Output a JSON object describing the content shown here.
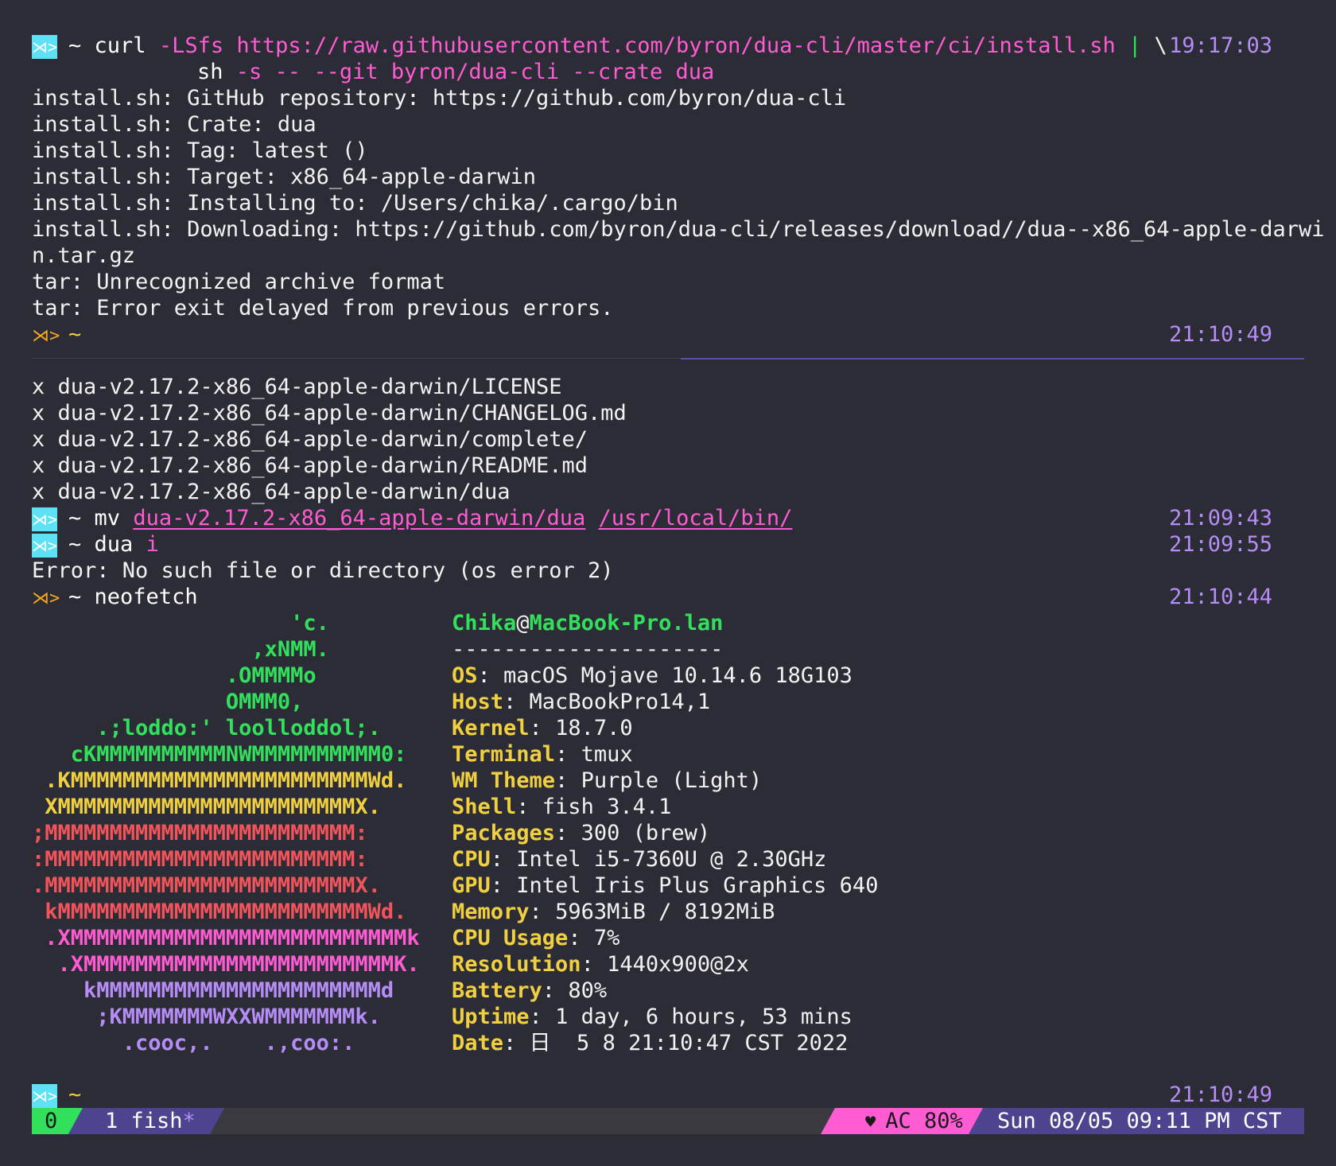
{
  "prompt_icon": "fish-prompt-icon",
  "colors": {
    "background": "#2c2c36",
    "time": "#b68cf7",
    "arg": "#ff5bd3",
    "green": "#32e05c",
    "yellow": "#f0d040",
    "cyan": "#5ee1f5",
    "purple": "#4c448f"
  },
  "block1": {
    "prompt_dir": "~",
    "cmd": "curl",
    "flag1": "-LSfs",
    "url": "https://raw.githubusercontent.com/byron/dua-cli/master/ci/install.sh",
    "pipe": "|",
    "backslash": "\\",
    "time": "19:17:03",
    "cont_cmd": "sh",
    "cont_args": "-s -- --git byron/dua-cli --crate dua",
    "output": [
      "install.sh: GitHub repository: https://github.com/byron/dua-cli",
      "install.sh: Crate: dua",
      "install.sh: Tag: latest ()",
      "install.sh: Target: x86_64-apple-darwin",
      "install.sh: Installing to: /Users/chika/.cargo/bin",
      "install.sh: Downloading: https://github.com/byron/dua-cli/releases/download//dua--x86_64-apple-darwi",
      "n.tar.gz",
      "tar: Unrecognized archive format",
      "tar: Error exit delayed from previous errors."
    ],
    "prompt2_dir": "~",
    "prompt2_time": "21:10:49"
  },
  "block2": {
    "tar_output": [
      "x dua-v2.17.2-x86_64-apple-darwin/LICENSE",
      "x dua-v2.17.2-x86_64-apple-darwin/CHANGELOG.md",
      "x dua-v2.17.2-x86_64-apple-darwin/complete/",
      "x dua-v2.17.2-x86_64-apple-darwin/README.md",
      "x dua-v2.17.2-x86_64-apple-darwin/dua"
    ],
    "mv": {
      "dir": "~",
      "cmd": "mv",
      "src": "dua-v2.17.2-x86_64-apple-darwin/dua",
      "dst": "/usr/local/bin/",
      "time": "21:09:43"
    },
    "dua": {
      "dir": "~",
      "cmd": "dua",
      "arg": "i",
      "time": "21:09:55"
    },
    "error": "Error: No such file or directory (os error 2)",
    "neofetch": {
      "dir": "~",
      "cmd": "neofetch",
      "time": "21:10:44"
    }
  },
  "neofetch": {
    "art": [
      {
        "text": "                    'c.",
        "color": "#32e05c"
      },
      {
        "text": "                 ,xNMM.",
        "color": "#32e05c"
      },
      {
        "text": "               .OMMMMo",
        "color": "#32e05c"
      },
      {
        "text": "               OMMM0,",
        "color": "#32e05c"
      },
      {
        "text": "     .;loddo:' loolloddol;.",
        "color": "#32e05c"
      },
      {
        "text": "   cKMMMMMMMMMMNWMMMMMMMMMM0:",
        "color": "#32e05c"
      },
      {
        "text": " .KMMMMMMMMMMMMMMMMMMMMMMMWd.",
        "color": "#f0d040"
      },
      {
        "text": " XMMMMMMMMMMMMMMMMMMMMMMMX.",
        "color": "#f0d040"
      },
      {
        "text": ";MMMMMMMMMMMMMMMMMMMMMMMM:",
        "color": "#f2545b"
      },
      {
        "text": ":MMMMMMMMMMMMMMMMMMMMMMMM:",
        "color": "#f2545b"
      },
      {
        "text": ".MMMMMMMMMMMMMMMMMMMMMMMMX.",
        "color": "#f2545b"
      },
      {
        "text": " kMMMMMMMMMMMMMMMMMMMMMMMMWd.",
        "color": "#f2545b"
      },
      {
        "text": " .XMMMMMMMMMMMMMMMMMMMMMMMMMMk",
        "color": "#ff5bd3"
      },
      {
        "text": "  .XMMMMMMMMMMMMMMMMMMMMMMMMK.",
        "color": "#ff5bd3"
      },
      {
        "text": "    kMMMMMMMMMMMMMMMMMMMMMMd",
        "color": "#b68cf7"
      },
      {
        "text": "     ;KMMMMMMMWXXWMMMMMMMk.",
        "color": "#b68cf7"
      },
      {
        "text": "       .cooc,.    .,coo:.",
        "color": "#b68cf7"
      }
    ],
    "user": "Chika",
    "at": "@",
    "host": "MacBook-Pro.lan",
    "divider": "---------------------",
    "info": [
      {
        "key": "OS",
        "value": "macOS Mojave 10.14.6 18G103"
      },
      {
        "key": "Host",
        "value": "MacBookPro14,1"
      },
      {
        "key": "Kernel",
        "value": "18.7.0"
      },
      {
        "key": "Terminal",
        "value": "tmux"
      },
      {
        "key": "WM Theme",
        "value": "Purple (Light)"
      },
      {
        "key": "Shell",
        "value": "fish 3.4.1"
      },
      {
        "key": "Packages",
        "value": "300 (brew)"
      },
      {
        "key": "CPU",
        "value": "Intel i5-7360U @ 2.30GHz"
      },
      {
        "key": "GPU",
        "value": "Intel Iris Plus Graphics 640"
      },
      {
        "key": "Memory",
        "value": "5963MiB / 8192MiB"
      },
      {
        "key": "CPU Usage",
        "value": "7%"
      },
      {
        "key": "Resolution",
        "value": "1440x900@2x"
      },
      {
        "key": "Battery",
        "value": "80%"
      },
      {
        "key": "Uptime",
        "value": "1 day, 6 hours, 53 mins"
      },
      {
        "key": "Date",
        "value": "日  5 8 21:10:47 CST 2022"
      }
    ]
  },
  "last_prompt": {
    "dir": "~",
    "time": "21:10:49"
  },
  "statusbar": {
    "session": "0",
    "window": "1 fish",
    "window_flag": "*",
    "battery_icon": "heart-icon",
    "battery": "AC 80%",
    "datetime": "Sun 08/05 09:11 PM CST"
  }
}
